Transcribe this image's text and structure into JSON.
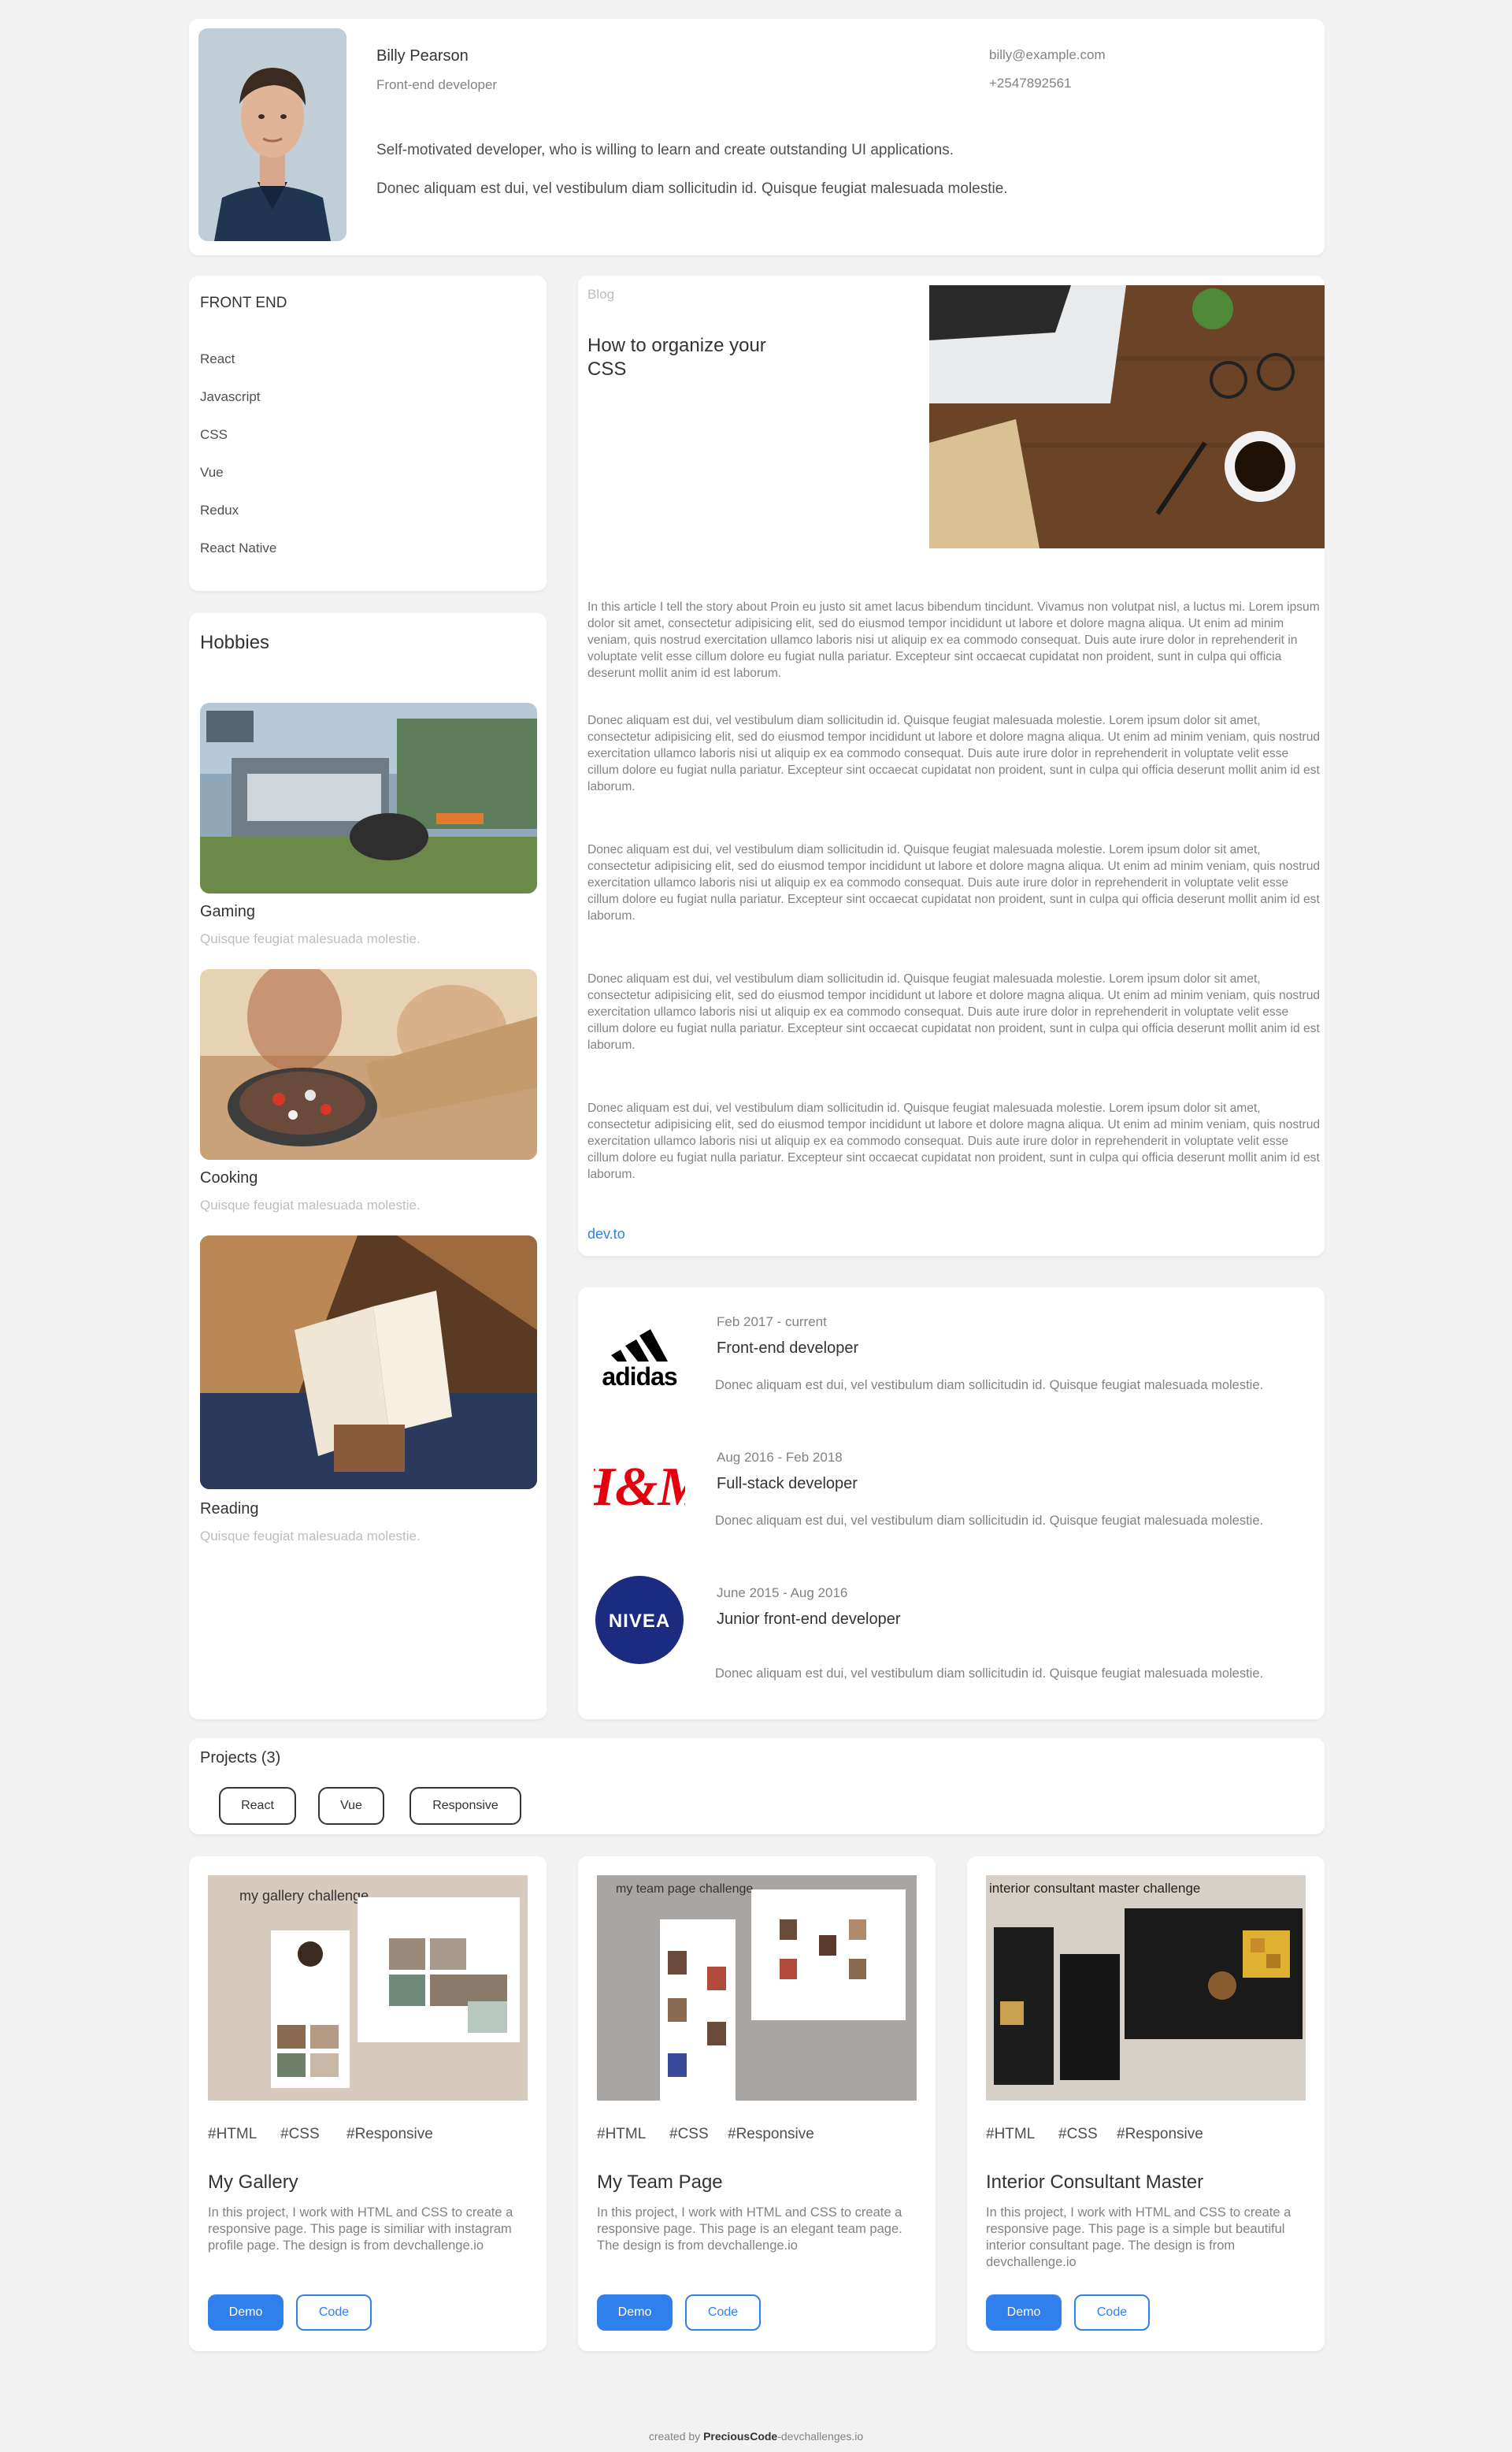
{
  "profile": {
    "name": "Billy Pearson",
    "role": "Front-end developer",
    "email": "billy@example.com",
    "phone": "+2547892561",
    "bio": [
      "Self-motivated developer, who is willing to learn and create outstanding UI applications.",
      "Donec aliquam est dui, vel vestibulum diam sollicitudin id. Quisque feugiat malesuada molestie."
    ]
  },
  "skills": {
    "title": "FRONT END",
    "items": [
      "React",
      "Javascript",
      "CSS",
      "Vue",
      "Redux",
      "React Native"
    ]
  },
  "hobbies": {
    "title": "Hobbies",
    "items": [
      {
        "title": "Gaming",
        "desc": "Quisque feugiat malesuada molestie."
      },
      {
        "title": "Cooking",
        "desc": "Quisque feugiat malesuada molestie."
      },
      {
        "title": "Reading",
        "desc": "Quisque feugiat malesuada molestie."
      }
    ]
  },
  "blog": {
    "label": "Blog",
    "title": "How to organize your CSS",
    "paragraphs": [
      "In this article I tell the story about Proin eu justo sit amet lacus bibendum tincidunt. Vivamus non volutpat nisl, a luctus mi. Lorem ipsum dolor sit amet, consectetur adipisicing elit, sed do eiusmod tempor incididunt ut labore et dolore magna aliqua. Ut enim ad minim veniam, quis nostrud exercitation ullamco laboris nisi ut aliquip ex ea commodo consequat. Duis aute irure dolor in reprehenderit in voluptate velit esse cillum dolore eu fugiat nulla pariatur. Excepteur sint occaecat cupidatat non proident, sunt in culpa qui officia deserunt mollit anim id est laborum.",
      "Donec aliquam est dui, vel vestibulum diam sollicitudin id. Quisque feugiat malesuada molestie. Lorem ipsum dolor sit amet, consectetur adipisicing elit, sed do eiusmod tempor incididunt ut labore et dolore magna aliqua. Ut enim ad minim veniam, quis nostrud exercitation ullamco laboris nisi ut aliquip ex ea commodo consequat. Duis aute irure dolor in reprehenderit in voluptate velit esse cillum dolore eu fugiat nulla pariatur. Excepteur sint occaecat cupidatat non proident, sunt in culpa qui officia deserunt mollit anim id est laborum.",
      "Donec aliquam est dui, vel vestibulum diam sollicitudin id. Quisque feugiat malesuada molestie. Lorem ipsum dolor sit amet, consectetur adipisicing elit, sed do eiusmod tempor incididunt ut labore et dolore magna aliqua. Ut enim ad minim veniam, quis nostrud exercitation ullamco laboris nisi ut aliquip ex ea commodo consequat. Duis aute irure dolor in reprehenderit in voluptate velit esse cillum dolore eu fugiat nulla pariatur. Excepteur sint occaecat cupidatat non proident, sunt in culpa qui officia deserunt mollit anim id est laborum.",
      "Donec aliquam est dui, vel vestibulum diam sollicitudin id. Quisque feugiat malesuada molestie. Lorem ipsum dolor sit amet, consectetur adipisicing elit, sed do eiusmod tempor incididunt ut labore et dolore magna aliqua. Ut enim ad minim veniam, quis nostrud exercitation ullamco laboris nisi ut aliquip ex ea commodo consequat. Duis aute irure dolor in reprehenderit in voluptate velit esse cillum dolore eu fugiat nulla pariatur. Excepteur sint occaecat cupidatat non proident, sunt in culpa qui officia deserunt mollit anim id est laborum.",
      "Donec aliquam est dui, vel vestibulum diam sollicitudin id. Quisque feugiat malesuada molestie. Lorem ipsum dolor sit amet, consectetur adipisicing elit, sed do eiusmod tempor incididunt ut labore et dolore magna aliqua. Ut enim ad minim veniam, quis nostrud exercitation ullamco laboris nisi ut aliquip ex ea commodo consequat. Duis aute irure dolor in reprehenderit in voluptate velit esse cillum dolore eu fugiat nulla pariatur. Excepteur sint occaecat cupidatat non proident, sunt in culpa qui officia deserunt mollit anim id est laborum."
    ],
    "link": "dev.to"
  },
  "experience": [
    {
      "company": "adidas",
      "date": "Feb 2017 - current",
      "role": "Front-end developer",
      "desc": "Donec aliquam est dui, vel vestibulum diam sollicitudin id. Quisque feugiat malesuada molestie."
    },
    {
      "company": "H&M",
      "date": "Aug 2016 - Feb 2018",
      "role": "Full-stack developer",
      "desc": "Donec aliquam est dui, vel vestibulum diam sollicitudin id. Quisque feugiat malesuada molestie."
    },
    {
      "company": "NIVEA",
      "date": "June 2015 - Aug 2016",
      "role": "Junior front-end developer",
      "desc": "Donec aliquam est dui, vel vestibulum diam sollicitudin id. Quisque feugiat malesuada molestie."
    }
  ],
  "projects": {
    "title": "Projects (3)",
    "filters": [
      "React",
      "Vue",
      "Responsive"
    ],
    "items": [
      {
        "thumb_label": "my gallery challenge",
        "tags": [
          "#HTML",
          "#CSS",
          "#Responsive"
        ],
        "title": "My Gallery",
        "desc": "In this project, I work with HTML and CSS to create a responsive page. This page is similiar with instagram profile page. The design is from devchallenge.io",
        "demo": "Demo",
        "code": "Code"
      },
      {
        "thumb_label": "my team page challenge",
        "tags": [
          "#HTML",
          "#CSS",
          "#Responsive"
        ],
        "title": "My Team Page",
        "desc": "In this project, I work with HTML and CSS to create a responsive page. This page is an elegant team page. The design is from devchallenge.io",
        "demo": "Demo",
        "code": "Code"
      },
      {
        "thumb_label": "interior consultant master challenge",
        "tags": [
          "#HTML",
          "#CSS",
          "#Responsive"
        ],
        "title": "Interior Consultant Master",
        "desc": "In this project, I work with HTML and CSS to create a responsive page. This page is a simple but beautiful interior consultant page. The design is from devchallenge.io",
        "demo": "Demo",
        "code": "Code"
      }
    ]
  },
  "footer": {
    "prefix": "created by ",
    "author": "PreciousCode",
    "suffix": "-devchallenges.io"
  },
  "colors": {
    "accent": "#2f80ed",
    "background": "#f2f2f2",
    "card": "#ffffff",
    "muted": "#bdbdbd"
  }
}
